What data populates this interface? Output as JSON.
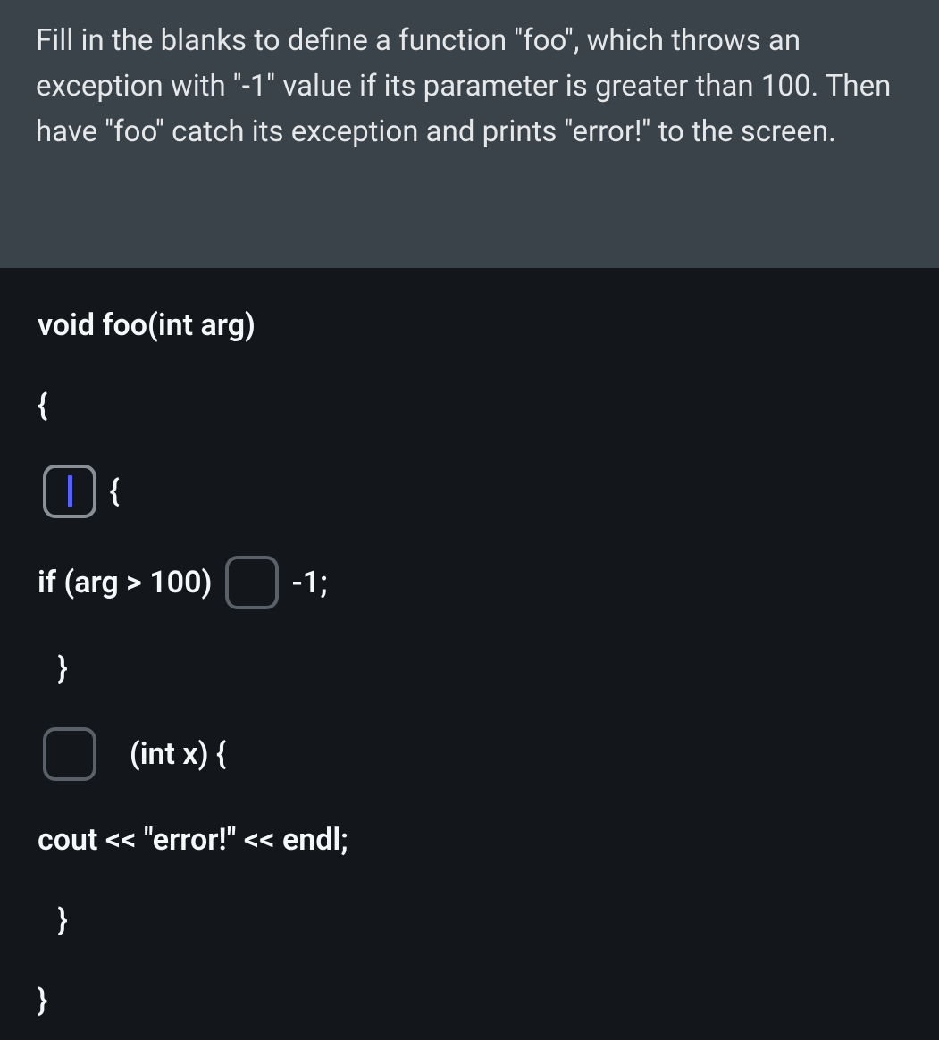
{
  "question": {
    "prompt": "Fill in the blanks to define a function ''foo'', which throws an exception with ''-1'' value if its parameter is greater than 100. Then have ''foo'' catch its exception and prints ''error!'' to the screen."
  },
  "code": {
    "line1": "void foo(int arg)",
    "line2": "{",
    "line3_after": " {",
    "line4_before": "if (arg > 100) ",
    "line4_after": " -1;",
    "line5": " }",
    "line6_after": "  (int x) {",
    "line7": "cout << \"error!\" << endl;",
    "line8": " }",
    "line9": "}"
  },
  "blanks": {
    "b1": "",
    "b2": "",
    "b3": ""
  }
}
